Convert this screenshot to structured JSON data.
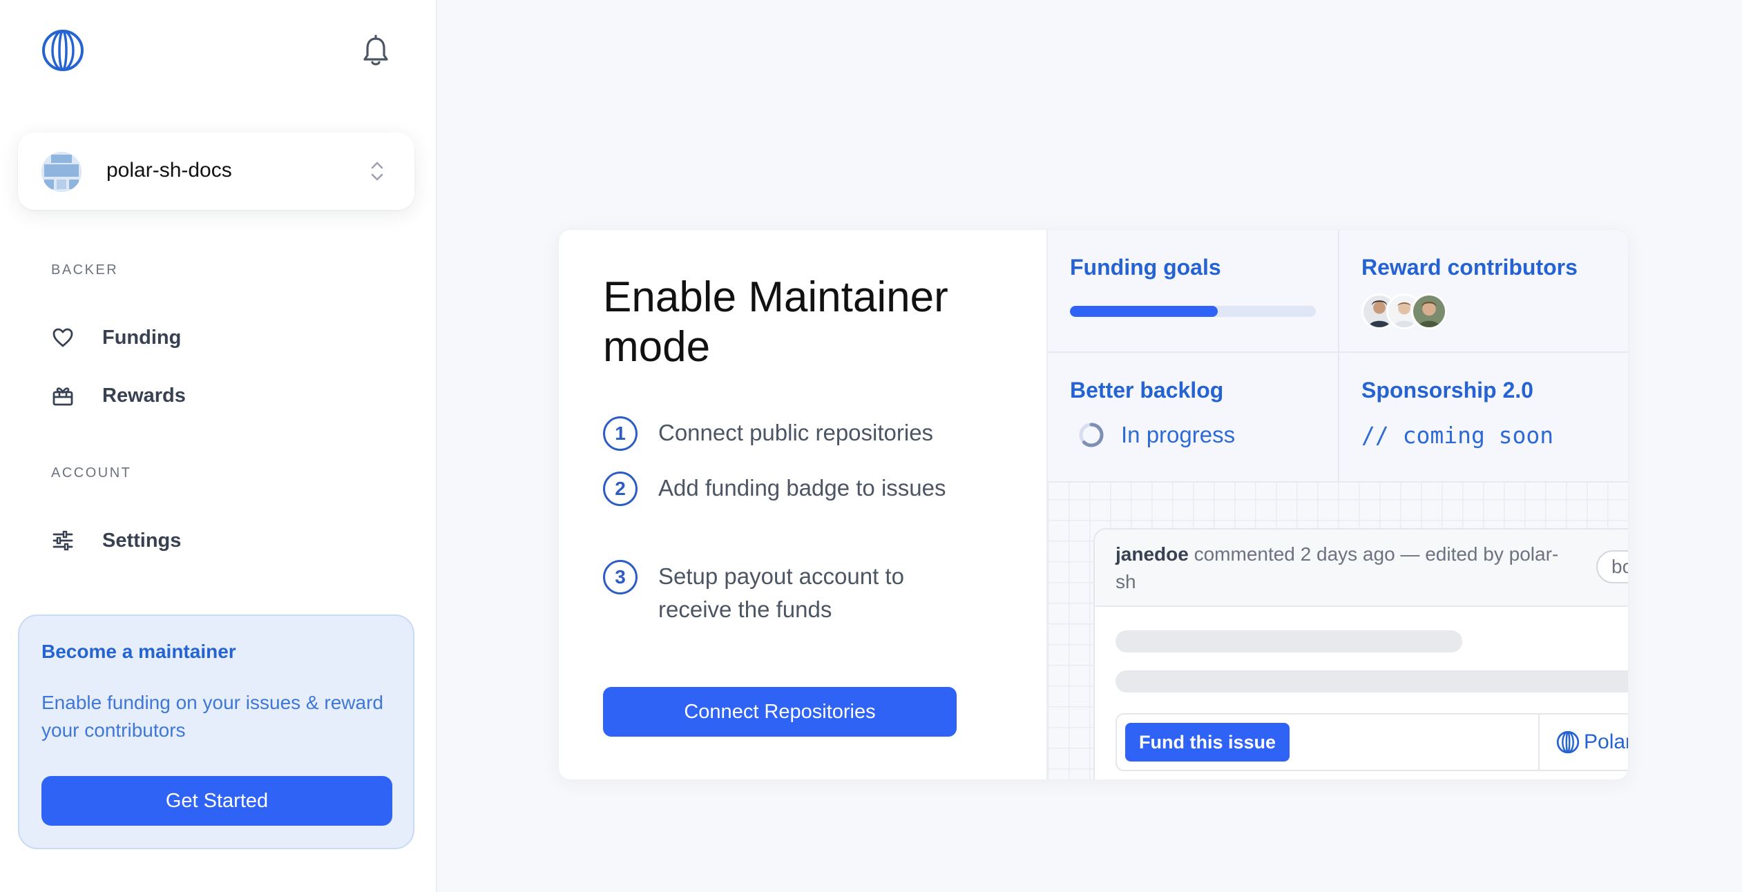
{
  "sidebar": {
    "org_name": "polar-sh-docs",
    "sections": {
      "backer": "BACKER",
      "account": "ACCOUNT"
    },
    "items": [
      {
        "label": "Funding",
        "icon": "heart-icon"
      },
      {
        "label": "Rewards",
        "icon": "gift-icon"
      },
      {
        "label": "Settings",
        "icon": "sliders-icon"
      }
    ],
    "promo": {
      "title": "Become a maintainer",
      "text": "Enable funding on your issues & reward your contributors",
      "button": "Get Started"
    }
  },
  "main": {
    "title": "Enable Maintainer mode",
    "steps": [
      {
        "num": "1",
        "text": "Connect public repositories"
      },
      {
        "num": "2",
        "text": "Add funding badge to issues"
      },
      {
        "num": "3",
        "text": "Setup payout account to receive the funds"
      }
    ],
    "connect_button": "Connect Repositories",
    "features": {
      "funding_goals": {
        "title": "Funding goals",
        "progress": 0.6
      },
      "reward_contributors": {
        "title": "Reward contributors"
      },
      "better_backlog": {
        "title": "Better backlog",
        "status": "In progress"
      },
      "sponsorship": {
        "title": "Sponsorship 2.0",
        "status": "// coming soon"
      }
    },
    "comment": {
      "author": "janedoe",
      "meta_rest": " commented 2 days ago — edited by polar-sh",
      "chip": "bo",
      "fund_button": "Fund this issue",
      "brand": "Polar"
    }
  },
  "colors": {
    "accent": "#2e63f5",
    "link": "#2463d1"
  }
}
